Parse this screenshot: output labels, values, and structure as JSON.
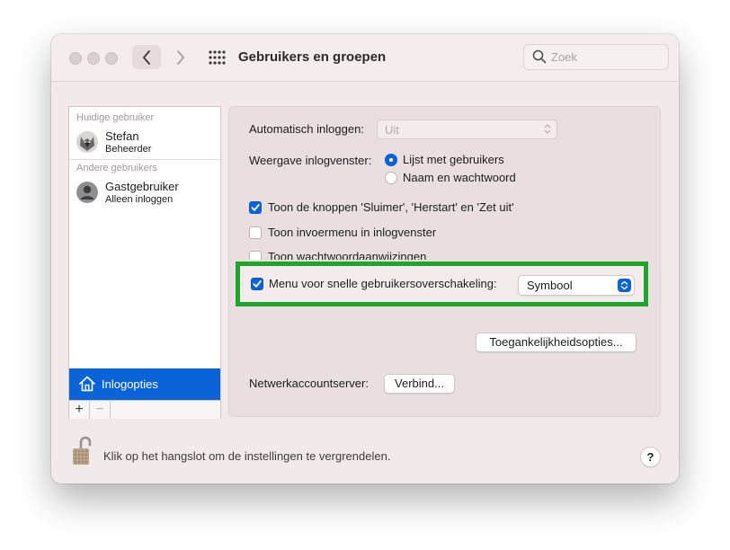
{
  "window": {
    "title": "Gebruikers en groepen",
    "search": {
      "placeholder": "Zoek",
      "value": ""
    }
  },
  "sidebar": {
    "current_header": "Huidige gebruiker",
    "current_user": {
      "name": "Stefan",
      "role": "Beheerder"
    },
    "others_header": "Andere gebruikers",
    "other_users": [
      {
        "name": "Gastgebruiker",
        "role": "Alleen inloggen"
      }
    ],
    "login_options_label": "Inlogopties",
    "add_label": "+",
    "remove_label": "−"
  },
  "main": {
    "auto_login_label": "Automatisch inloggen:",
    "auto_login_value": "Uit",
    "display_label": "Weergave inlogvenster:",
    "display_options": [
      {
        "label": "Lijst met gebruikers",
        "selected": true
      },
      {
        "label": "Naam en wachtwoord",
        "selected": false
      }
    ],
    "checkboxes": [
      {
        "label": "Toon de knoppen 'Sluimer', 'Herstart' en 'Zet uit'",
        "checked": true
      },
      {
        "label": "Toon invoermenu in inlogvenster",
        "checked": false
      },
      {
        "label": "Toon wachtwoordaanwijzingen",
        "checked": false
      }
    ],
    "fast_switch": {
      "label": "Menu voor snelle gebruikersoverschakeling:",
      "checked": true,
      "value": "Symbool"
    },
    "accessibility_button": "Toegankelijkheidsopties...",
    "network_label": "Netwerkaccountserver:",
    "network_button": "Verbind..."
  },
  "footer": {
    "lock_text": "Klik op het hangslot om de instellingen te vergrendelen.",
    "help_label": "?"
  },
  "colors": {
    "accent": "#0a64d8",
    "highlight": "#1ea52c",
    "window_bg": "#f2e9ea"
  }
}
